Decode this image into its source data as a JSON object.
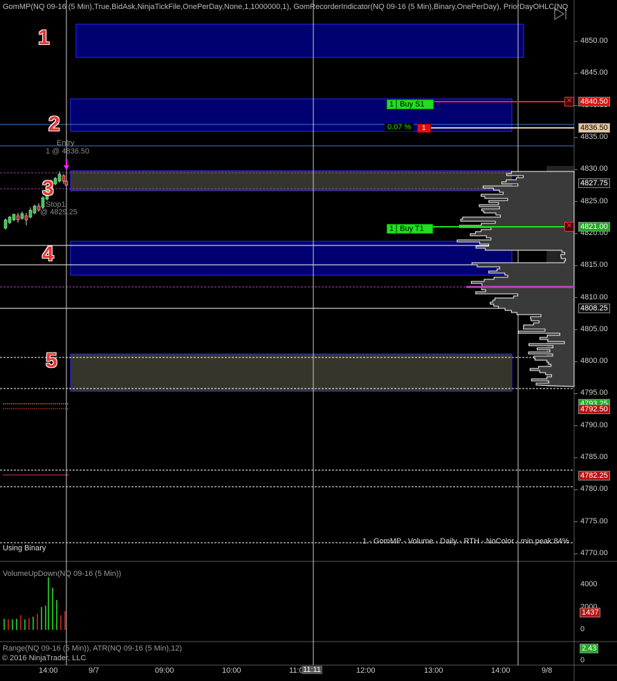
{
  "header": {
    "indicator_text": "GomMP(NQ 09-16 (5 Min),True,BidAsk,NinjaTickFile,OnePerDay,None,1,1000000,1), GomRecorderIndicator(NQ 09-16 (5 Min),Binary,OnePerDay), PriorDayOHLC(NQ"
  },
  "zone_numbers": [
    "1",
    "2",
    "3",
    "4",
    "5"
  ],
  "price_axis": {
    "ticks": [
      "4850.00",
      "4845.00",
      "4840.00",
      "4835.00",
      "4830.00",
      "4825.00",
      "4820.00",
      "4815.00",
      "4810.00",
      "4805.00",
      "4800.00",
      "4795.00",
      "4790.00",
      "4785.00",
      "4780.00",
      "4775.00",
      "4770.00"
    ],
    "badges": [
      "4840.50",
      "4836.50",
      "4827.75",
      "4821.00",
      "4808.25",
      "4793.25",
      "4792.50",
      "4782.25"
    ]
  },
  "orders": {
    "stop": {
      "qty": "1",
      "label": "Buy S1",
      "price": "4840.50"
    },
    "target": {
      "qty": "1",
      "label": "Buy T1",
      "price": "4821.00"
    },
    "position": {
      "pct": "0.07 %",
      "qty": "1",
      "price": "4836.50"
    }
  },
  "annotations": {
    "entry": "Entry",
    "entry_fill": "1 @ 4836.50",
    "stop": "Stop1",
    "stop_fill": "@ 4829.25"
  },
  "volume_profile_label": "1 - GomMP - Volume - Daily - RTH - NoColor - min peak:84%",
  "using_binary": "Using Binary",
  "volume_panel": {
    "title": "VolumeUpDown(NQ 09-16 (5 Min))",
    "ticks": [
      "4000",
      "2000",
      "0"
    ],
    "badge": "1437"
  },
  "range_panel": {
    "title": "Range(NQ 09-16 (5 Min)), ATR(NQ 09-16 (5 Min),12)",
    "ticks": [
      "0"
    ],
    "badge": "2.43"
  },
  "time_axis": {
    "ticks": [
      "14:00",
      "9/7",
      "09:00",
      "10:00",
      "11:00",
      "12:00",
      "13:00",
      "14:00",
      "9/8"
    ],
    "cursor": "11:11"
  },
  "copyright": "© 2016 NinjaTrader, LLC",
  "colors": {
    "background": "#000000",
    "zone_blue": "#000080",
    "zone_gray": "#333329",
    "up_candle": "#2ecc40",
    "down_candle": "#cc2020",
    "stop_line": "#ff2020",
    "target_line": "#20e020",
    "position_line": "#e8c8a0",
    "poc_line": "#c040c0"
  }
}
